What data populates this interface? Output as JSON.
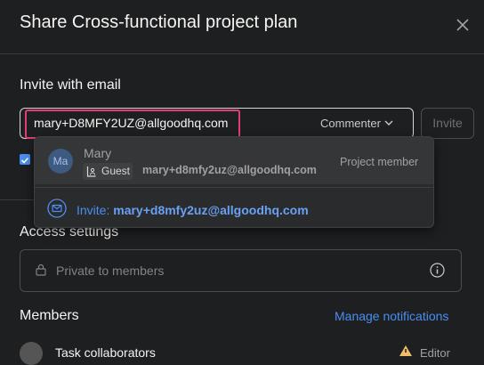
{
  "dialog": {
    "title": "Share Cross-functional project plan"
  },
  "invite": {
    "label": "Invite with email",
    "email_value": "mary+D8MFY2UZ@allgoodhq.com",
    "role": "Commenter",
    "button": "Invite"
  },
  "suggestions": {
    "user": {
      "avatar_initials": "Ma",
      "name": "Mary",
      "badge": "Guest",
      "email": "mary+d8mfy2uz@allgoodhq.com",
      "role": "Project member"
    },
    "invite_prefix": "Invite:",
    "invite_email": "mary+d8mfy2uz@allgoodhq.com"
  },
  "access": {
    "label": "Access settings",
    "value": "Private to members"
  },
  "members": {
    "label": "Members",
    "manage_link": "Manage notifications",
    "rows": [
      {
        "name": "Task collaborators",
        "role": "Editor"
      }
    ]
  },
  "colors": {
    "background": "#1e1f21",
    "accent": "#4a8ef1",
    "highlight": "#e23d7b"
  }
}
